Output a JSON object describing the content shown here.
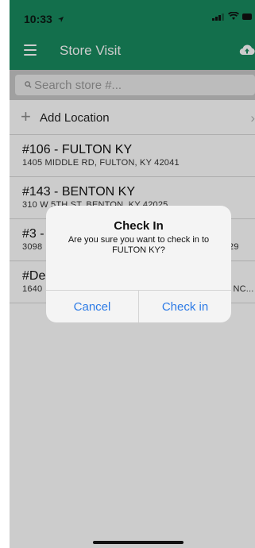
{
  "status_bar": {
    "time": "10:33",
    "icons": [
      "location-arrow-icon",
      "cellular-signal-icon",
      "wifi-icon",
      "battery-icon"
    ]
  },
  "app_bar": {
    "title": "Store Visit",
    "menu_icon": "menu-icon",
    "upload_icon": "cloud-upload-icon",
    "color": "#188b5f"
  },
  "search": {
    "placeholder": "Search store #...",
    "value": ""
  },
  "add_location": {
    "label": "Add Location",
    "icon": "plus-icon"
  },
  "stores": [
    {
      "name": "#106 - FULTON KY",
      "address": "1405 MIDDLE RD, FULTON, KY 42041"
    },
    {
      "name": "#143 - BENTON KY",
      "address": "310 W 5TH ST, BENTON, KY 42025"
    },
    {
      "name": "#3 - COMMERCE GA",
      "address": "3098",
      "address_suffix": "29"
    },
    {
      "name": "#De",
      "address": "1640",
      "address_suffix": ", NC..."
    }
  ],
  "dialog": {
    "title": "Check In",
    "message": "Are you sure you want to check in to FULTON KY?",
    "cancel_label": "Cancel",
    "confirm_label": "Check in",
    "button_color": "#2d7be6"
  }
}
